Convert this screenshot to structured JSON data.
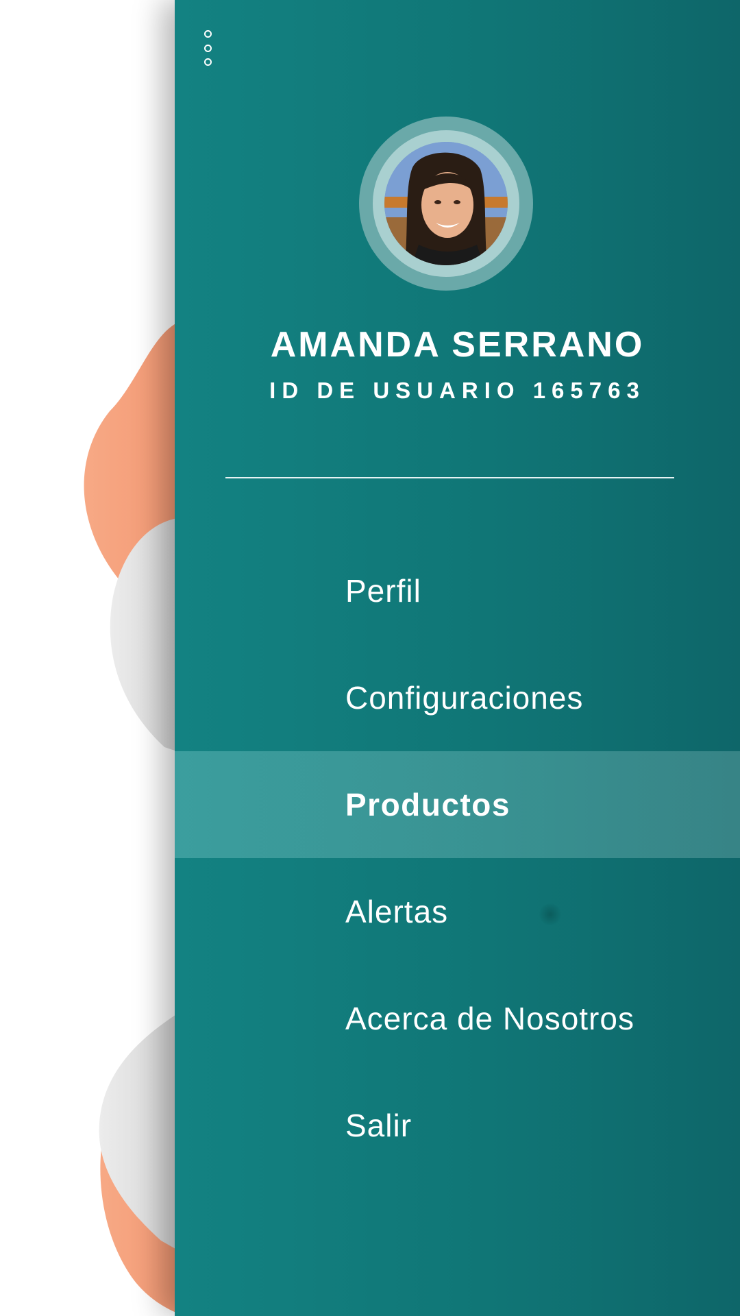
{
  "drawer": {
    "more_icon": "more-vertical-icon",
    "user": {
      "name": "AMANDA SERRANO",
      "id_label": "ID DE USUARIO 165763",
      "avatar": "avatar-photo"
    },
    "menu": [
      {
        "label": "Perfil",
        "active": false
      },
      {
        "label": "Configuraciones",
        "active": false
      },
      {
        "label": "Productos",
        "active": true
      },
      {
        "label": "Alertas",
        "active": false
      },
      {
        "label": "Acerca de Nosotros",
        "active": false
      },
      {
        "label": "Salir",
        "active": false
      }
    ]
  },
  "colors": {
    "drawer_bg": "#107676",
    "accent_blob": "#f5a07d",
    "gray_blob": "#e3e3e3",
    "text": "#ffffff"
  }
}
